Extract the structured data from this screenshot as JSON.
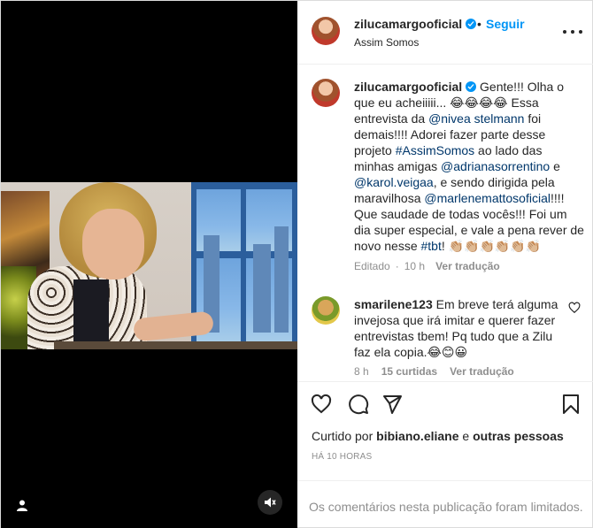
{
  "post": {
    "username": "zilucamargooficial",
    "follow_label": "Seguir",
    "separator_dot": "•",
    "location": "Assim Somos",
    "more_icon": "more-horizontal-icon"
  },
  "caption": {
    "username": "zilucamargooficial",
    "text_1": " Gente!!! Olha o que eu acheiiiii... 😂😂😂😂 Essa entrevista da ",
    "tag_1": "@nivea stelmann",
    "text_2": " foi demais!!!! Adorei fazer parte desse projeto ",
    "tag_2": "#AssimSomos",
    "text_3": " ao lado das minhas amigas ",
    "tag_3": "@adrianasorrentino",
    "text_4": " e ",
    "tag_4": "@karol.veigaa",
    "text_5": ", e sendo dirigida pela maravilhosa ",
    "tag_5": "@marlenemattosoficial",
    "text_6": "!!!! Que saudade de todas vocês!!! Foi um dia super especial, e vale a pena rever de novo nesse ",
    "tag_6": "#tbt",
    "text_7": "! 👏🏼👏🏼👏🏼👏🏼👏🏼👏🏼",
    "edited": "Editado",
    "time": "10 h",
    "translate": "Ver tradução"
  },
  "comment": {
    "username": "smarilene123",
    "text": " Em breve terá alguma invejosa que irá imitar e querer fazer entrevistas tbem! Pq tudo que a Zilu faz ela copia.😂😊😀",
    "time": "8 h",
    "likes": "15 curtidas",
    "translate": "Ver tradução"
  },
  "actions": {
    "like_icon": "heart-icon",
    "comment_icon": "comment-icon",
    "share_icon": "send-icon",
    "save_icon": "bookmark-icon"
  },
  "liked_by": {
    "prefix": "Curtido por ",
    "user": "bibiano.eliane",
    "middle": " e ",
    "others": "outras pessoas"
  },
  "timeago": "HÁ 10 HORAS",
  "comments_limited": "Os comentários nesta publicação foram limitados."
}
